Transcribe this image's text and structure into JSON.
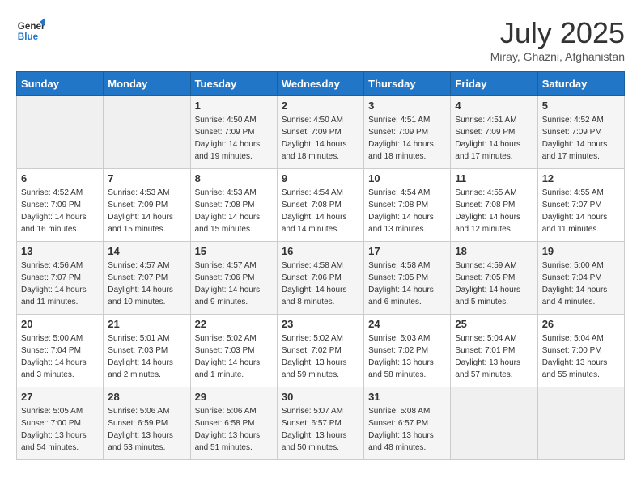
{
  "header": {
    "logo_line1": "General",
    "logo_line2": "Blue",
    "month_year": "July 2025",
    "location": "Miray, Ghazni, Afghanistan"
  },
  "weekdays": [
    "Sunday",
    "Monday",
    "Tuesday",
    "Wednesday",
    "Thursday",
    "Friday",
    "Saturday"
  ],
  "weeks": [
    [
      {
        "day": "",
        "sunrise": "",
        "sunset": "",
        "daylight": ""
      },
      {
        "day": "",
        "sunrise": "",
        "sunset": "",
        "daylight": ""
      },
      {
        "day": "1",
        "sunrise": "Sunrise: 4:50 AM",
        "sunset": "Sunset: 7:09 PM",
        "daylight": "Daylight: 14 hours and 19 minutes."
      },
      {
        "day": "2",
        "sunrise": "Sunrise: 4:50 AM",
        "sunset": "Sunset: 7:09 PM",
        "daylight": "Daylight: 14 hours and 18 minutes."
      },
      {
        "day": "3",
        "sunrise": "Sunrise: 4:51 AM",
        "sunset": "Sunset: 7:09 PM",
        "daylight": "Daylight: 14 hours and 18 minutes."
      },
      {
        "day": "4",
        "sunrise": "Sunrise: 4:51 AM",
        "sunset": "Sunset: 7:09 PM",
        "daylight": "Daylight: 14 hours and 17 minutes."
      },
      {
        "day": "5",
        "sunrise": "Sunrise: 4:52 AM",
        "sunset": "Sunset: 7:09 PM",
        "daylight": "Daylight: 14 hours and 17 minutes."
      }
    ],
    [
      {
        "day": "6",
        "sunrise": "Sunrise: 4:52 AM",
        "sunset": "Sunset: 7:09 PM",
        "daylight": "Daylight: 14 hours and 16 minutes."
      },
      {
        "day": "7",
        "sunrise": "Sunrise: 4:53 AM",
        "sunset": "Sunset: 7:09 PM",
        "daylight": "Daylight: 14 hours and 15 minutes."
      },
      {
        "day": "8",
        "sunrise": "Sunrise: 4:53 AM",
        "sunset": "Sunset: 7:08 PM",
        "daylight": "Daylight: 14 hours and 15 minutes."
      },
      {
        "day": "9",
        "sunrise": "Sunrise: 4:54 AM",
        "sunset": "Sunset: 7:08 PM",
        "daylight": "Daylight: 14 hours and 14 minutes."
      },
      {
        "day": "10",
        "sunrise": "Sunrise: 4:54 AM",
        "sunset": "Sunset: 7:08 PM",
        "daylight": "Daylight: 14 hours and 13 minutes."
      },
      {
        "day": "11",
        "sunrise": "Sunrise: 4:55 AM",
        "sunset": "Sunset: 7:08 PM",
        "daylight": "Daylight: 14 hours and 12 minutes."
      },
      {
        "day": "12",
        "sunrise": "Sunrise: 4:55 AM",
        "sunset": "Sunset: 7:07 PM",
        "daylight": "Daylight: 14 hours and 11 minutes."
      }
    ],
    [
      {
        "day": "13",
        "sunrise": "Sunrise: 4:56 AM",
        "sunset": "Sunset: 7:07 PM",
        "daylight": "Daylight: 14 hours and 11 minutes."
      },
      {
        "day": "14",
        "sunrise": "Sunrise: 4:57 AM",
        "sunset": "Sunset: 7:07 PM",
        "daylight": "Daylight: 14 hours and 10 minutes."
      },
      {
        "day": "15",
        "sunrise": "Sunrise: 4:57 AM",
        "sunset": "Sunset: 7:06 PM",
        "daylight": "Daylight: 14 hours and 9 minutes."
      },
      {
        "day": "16",
        "sunrise": "Sunrise: 4:58 AM",
        "sunset": "Sunset: 7:06 PM",
        "daylight": "Daylight: 14 hours and 8 minutes."
      },
      {
        "day": "17",
        "sunrise": "Sunrise: 4:58 AM",
        "sunset": "Sunset: 7:05 PM",
        "daylight": "Daylight: 14 hours and 6 minutes."
      },
      {
        "day": "18",
        "sunrise": "Sunrise: 4:59 AM",
        "sunset": "Sunset: 7:05 PM",
        "daylight": "Daylight: 14 hours and 5 minutes."
      },
      {
        "day": "19",
        "sunrise": "Sunrise: 5:00 AM",
        "sunset": "Sunset: 7:04 PM",
        "daylight": "Daylight: 14 hours and 4 minutes."
      }
    ],
    [
      {
        "day": "20",
        "sunrise": "Sunrise: 5:00 AM",
        "sunset": "Sunset: 7:04 PM",
        "daylight": "Daylight: 14 hours and 3 minutes."
      },
      {
        "day": "21",
        "sunrise": "Sunrise: 5:01 AM",
        "sunset": "Sunset: 7:03 PM",
        "daylight": "Daylight: 14 hours and 2 minutes."
      },
      {
        "day": "22",
        "sunrise": "Sunrise: 5:02 AM",
        "sunset": "Sunset: 7:03 PM",
        "daylight": "Daylight: 14 hours and 1 minute."
      },
      {
        "day": "23",
        "sunrise": "Sunrise: 5:02 AM",
        "sunset": "Sunset: 7:02 PM",
        "daylight": "Daylight: 13 hours and 59 minutes."
      },
      {
        "day": "24",
        "sunrise": "Sunrise: 5:03 AM",
        "sunset": "Sunset: 7:02 PM",
        "daylight": "Daylight: 13 hours and 58 minutes."
      },
      {
        "day": "25",
        "sunrise": "Sunrise: 5:04 AM",
        "sunset": "Sunset: 7:01 PM",
        "daylight": "Daylight: 13 hours and 57 minutes."
      },
      {
        "day": "26",
        "sunrise": "Sunrise: 5:04 AM",
        "sunset": "Sunset: 7:00 PM",
        "daylight": "Daylight: 13 hours and 55 minutes."
      }
    ],
    [
      {
        "day": "27",
        "sunrise": "Sunrise: 5:05 AM",
        "sunset": "Sunset: 7:00 PM",
        "daylight": "Daylight: 13 hours and 54 minutes."
      },
      {
        "day": "28",
        "sunrise": "Sunrise: 5:06 AM",
        "sunset": "Sunset: 6:59 PM",
        "daylight": "Daylight: 13 hours and 53 minutes."
      },
      {
        "day": "29",
        "sunrise": "Sunrise: 5:06 AM",
        "sunset": "Sunset: 6:58 PM",
        "daylight": "Daylight: 13 hours and 51 minutes."
      },
      {
        "day": "30",
        "sunrise": "Sunrise: 5:07 AM",
        "sunset": "Sunset: 6:57 PM",
        "daylight": "Daylight: 13 hours and 50 minutes."
      },
      {
        "day": "31",
        "sunrise": "Sunrise: 5:08 AM",
        "sunset": "Sunset: 6:57 PM",
        "daylight": "Daylight: 13 hours and 48 minutes."
      },
      {
        "day": "",
        "sunrise": "",
        "sunset": "",
        "daylight": ""
      },
      {
        "day": "",
        "sunrise": "",
        "sunset": "",
        "daylight": ""
      }
    ]
  ]
}
